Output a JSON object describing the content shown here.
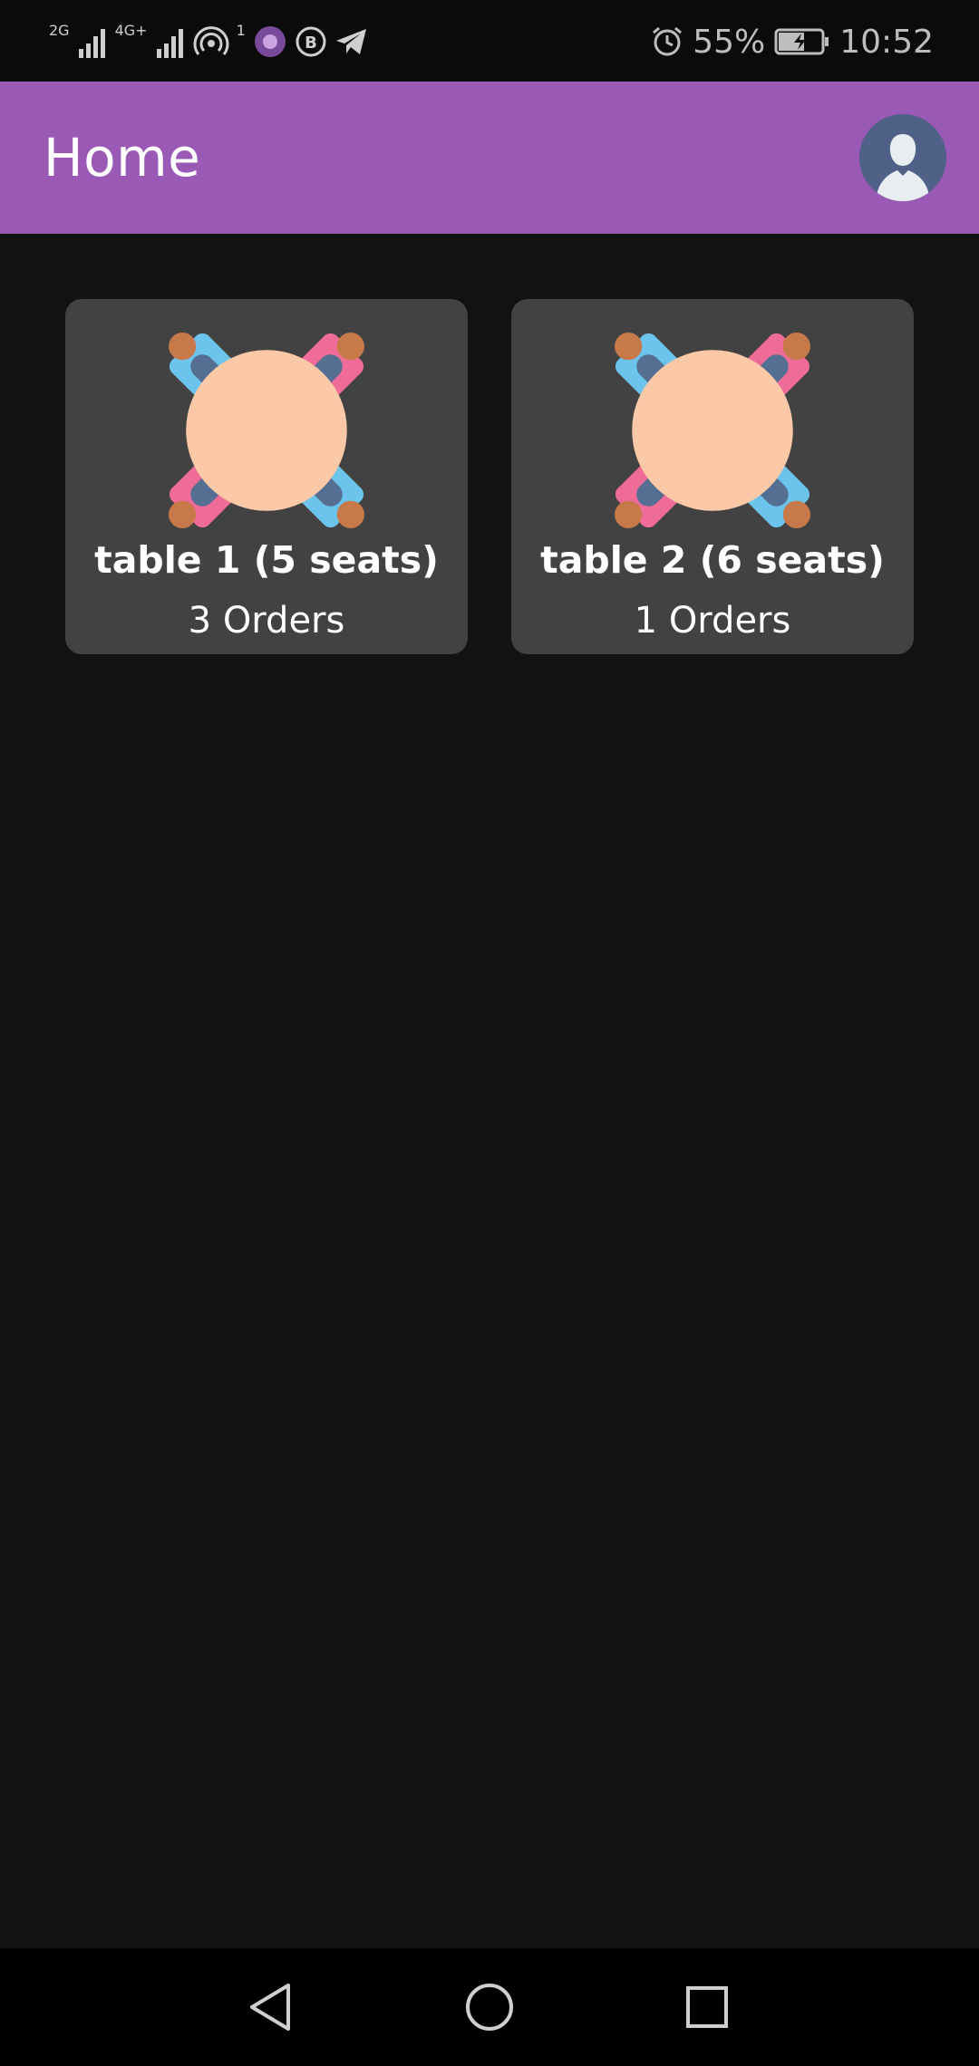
{
  "status_bar": {
    "signal1_label": "2G",
    "signal2_label": "4G+",
    "hotspot_count": "1",
    "battery": "55%",
    "time": "10:52"
  },
  "app_bar": {
    "title": "Home"
  },
  "tables": [
    {
      "title": "table 1 (5 seats)",
      "orders": "3 Orders"
    },
    {
      "title": "table 2 (6 seats)",
      "orders": "1 Orders"
    }
  ],
  "colors": {
    "app_bar": "#9b59b6",
    "background": "#121212",
    "card": "#424242"
  }
}
